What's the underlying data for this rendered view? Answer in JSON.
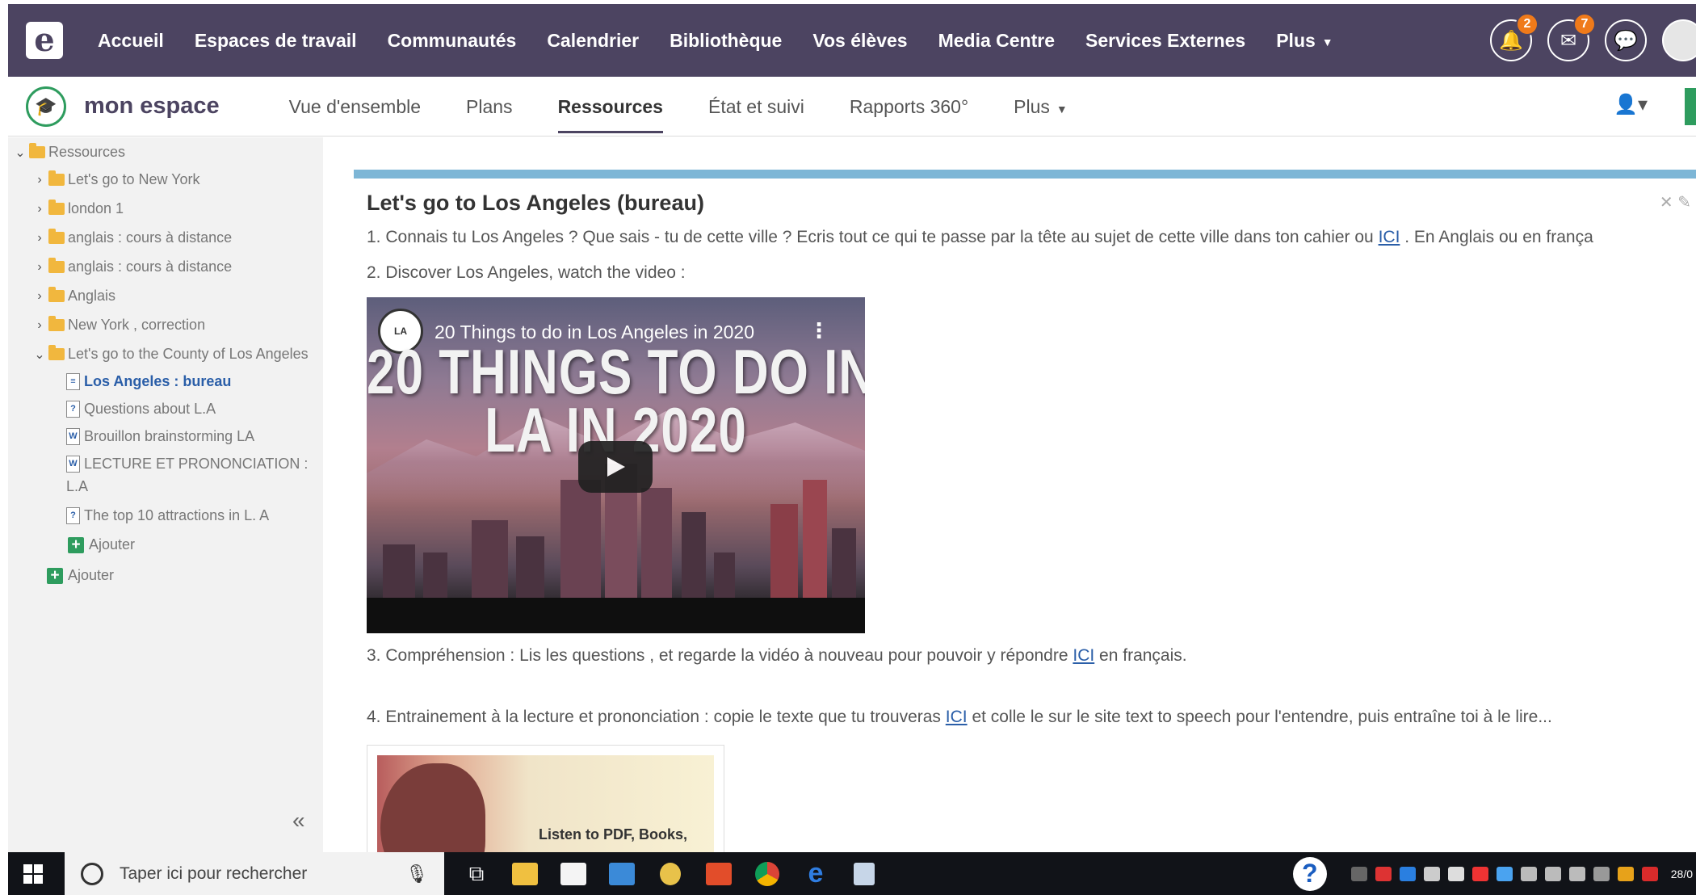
{
  "topnav": {
    "logo_letter": "e",
    "items": [
      {
        "label": "Accueil"
      },
      {
        "label": "Espaces de travail"
      },
      {
        "label": "Communautés"
      },
      {
        "label": "Calendrier"
      },
      {
        "label": "Bibliothèque"
      },
      {
        "label": "Vos élèves"
      },
      {
        "label": "Media Centre"
      },
      {
        "label": "Services Externes"
      },
      {
        "label": "Plus"
      }
    ],
    "notifications_count": "2",
    "messages_count": "7"
  },
  "subnav": {
    "title": "mon espace",
    "items": [
      {
        "label": "Vue d'ensemble"
      },
      {
        "label": "Plans"
      },
      {
        "label": "Ressources"
      },
      {
        "label": "État et suivi"
      },
      {
        "label": "Rapports 360°"
      },
      {
        "label": "Plus"
      }
    ]
  },
  "sidebar": {
    "root": "Ressources",
    "folders": [
      {
        "label": "Let's go to New York"
      },
      {
        "label": "london 1"
      },
      {
        "label": "anglais : cours à distance"
      },
      {
        "label": "anglais : cours à distance"
      },
      {
        "label": "Anglais"
      },
      {
        "label": "New York , correction"
      },
      {
        "label": "Let's go to the County of Los Angeles"
      }
    ],
    "children": [
      {
        "label": "Los Angeles : bureau",
        "icon": "page-icon"
      },
      {
        "label": "Questions about L.A",
        "icon": "quiz-icon"
      },
      {
        "label": "Brouillon brainstorming LA",
        "icon": "word-doc-icon"
      },
      {
        "label": "LECTURE ET PRONONCIATION :",
        "label2": "L.A",
        "icon": "word-doc-icon"
      },
      {
        "label": "The top 10 attractions in L. A",
        "icon": "quiz-icon"
      }
    ],
    "add_child_label": "Ajouter",
    "add_root_label": "Ajouter",
    "collapse_glyph": "«"
  },
  "resource": {
    "title": "Let's go to Los Angeles (bureau)",
    "para1_before": "1. Connais tu Los Angeles ? Que sais - tu de cette ville ? Ecris tout ce qui te passe par la tête au sujet de cette ville dans ton cahier ou ",
    "para1_link": "ICI",
    "para1_after": " . En Anglais ou en frança",
    "para2": "2. Discover Los Angeles, watch the video :",
    "video_caption": "20 Things to do in Los Angeles in 2020",
    "video_big_line1": "20 THINGS TO DO IN",
    "video_big_line2": "LA IN 2020",
    "para3_before": "3. Compréhension : Lis les questions , et regarde la vidéo à nouveau pour pouvoir y répondre ",
    "para3_link": "ICI",
    "para3_after": " en français.",
    "para4_before": "4. Entrainement à la lecture et prononciation  : copie le texte que tu trouveras ",
    "para4_link": "ICI",
    "para4_after": " et colle le sur le site text to speech pour l'entendre, puis entraîne toi à le lire...",
    "thumb_text": "Listen to PDF, Books,"
  },
  "taskbar": {
    "search_placeholder": "Taper ici pour rechercher",
    "date_partial": "28/0"
  },
  "colors": {
    "nav_bg": "#4c4461",
    "accent_green": "#2e9c5e",
    "badge_orange": "#ef7a1a",
    "link_blue": "#2a5ea8",
    "rule_blue": "#7db6d6"
  }
}
